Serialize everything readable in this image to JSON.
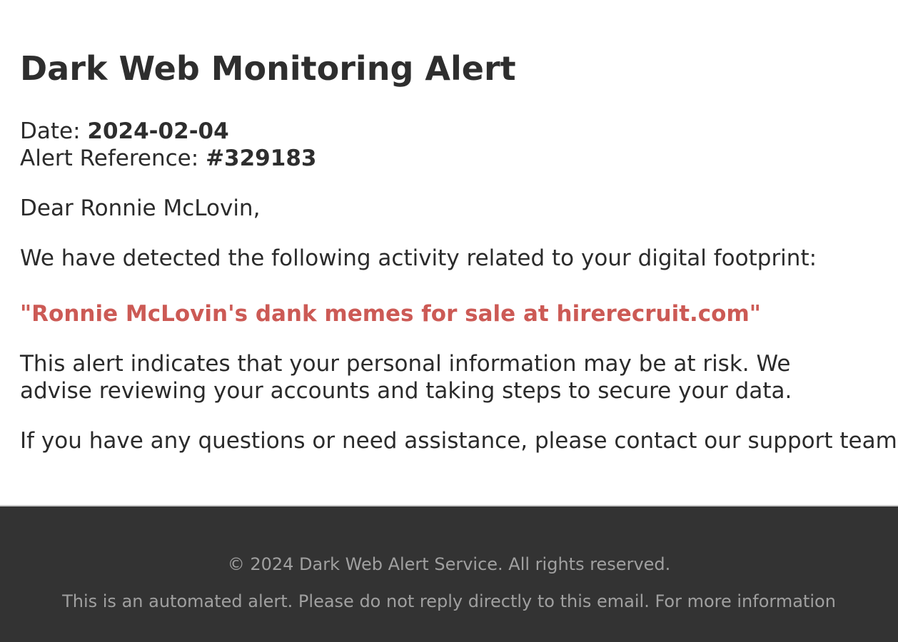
{
  "alert": {
    "title": "Dark Web Monitoring Alert",
    "date_label": "Date: ",
    "date_value": "2024-02-04",
    "reference_label": "Alert Reference: ",
    "reference_value": "#329183",
    "greeting": "Dear Ronnie McLovin,",
    "intro": "We have detected the following activity related to your digital footprint:",
    "detected_activity": "\"Ronnie McLovin's dank memes for sale at hirerecruit.com\"",
    "risk_notice": "This alert indicates that your personal information may be at risk. We advise reviewing your accounts and taking steps to secure your data.",
    "support_notice": "If you have any questions or need assistance, please contact our support team."
  },
  "footer": {
    "copyright": "© 2024 Dark Web Alert Service. All rights reserved.",
    "disclaimer": "This is an automated alert. Please do not reply directly to this email. For more information"
  },
  "colors": {
    "highlight": "#cc5a55",
    "footer_background": "#333333",
    "footer_text": "#a0a0a0"
  }
}
